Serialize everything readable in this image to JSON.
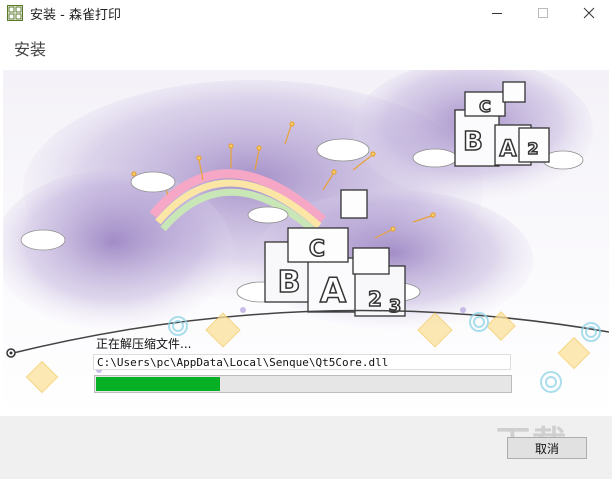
{
  "window": {
    "title": "安装 - 森雀打印"
  },
  "header": {
    "title": "安装"
  },
  "install": {
    "status": "正在解压缩文件...",
    "current_file": "C:\\Users\\pc\\AppData\\Local\\Senque\\Qt5Core.dll",
    "progress_percent": 30
  },
  "footer": {
    "cancel_label": "取消",
    "watermark": "下载"
  },
  "hero": {
    "block_letters": [
      "C",
      "B",
      "A",
      "2",
      "3"
    ]
  },
  "colors": {
    "progress_fill": "#06b025",
    "accent": "#9a86c4"
  }
}
